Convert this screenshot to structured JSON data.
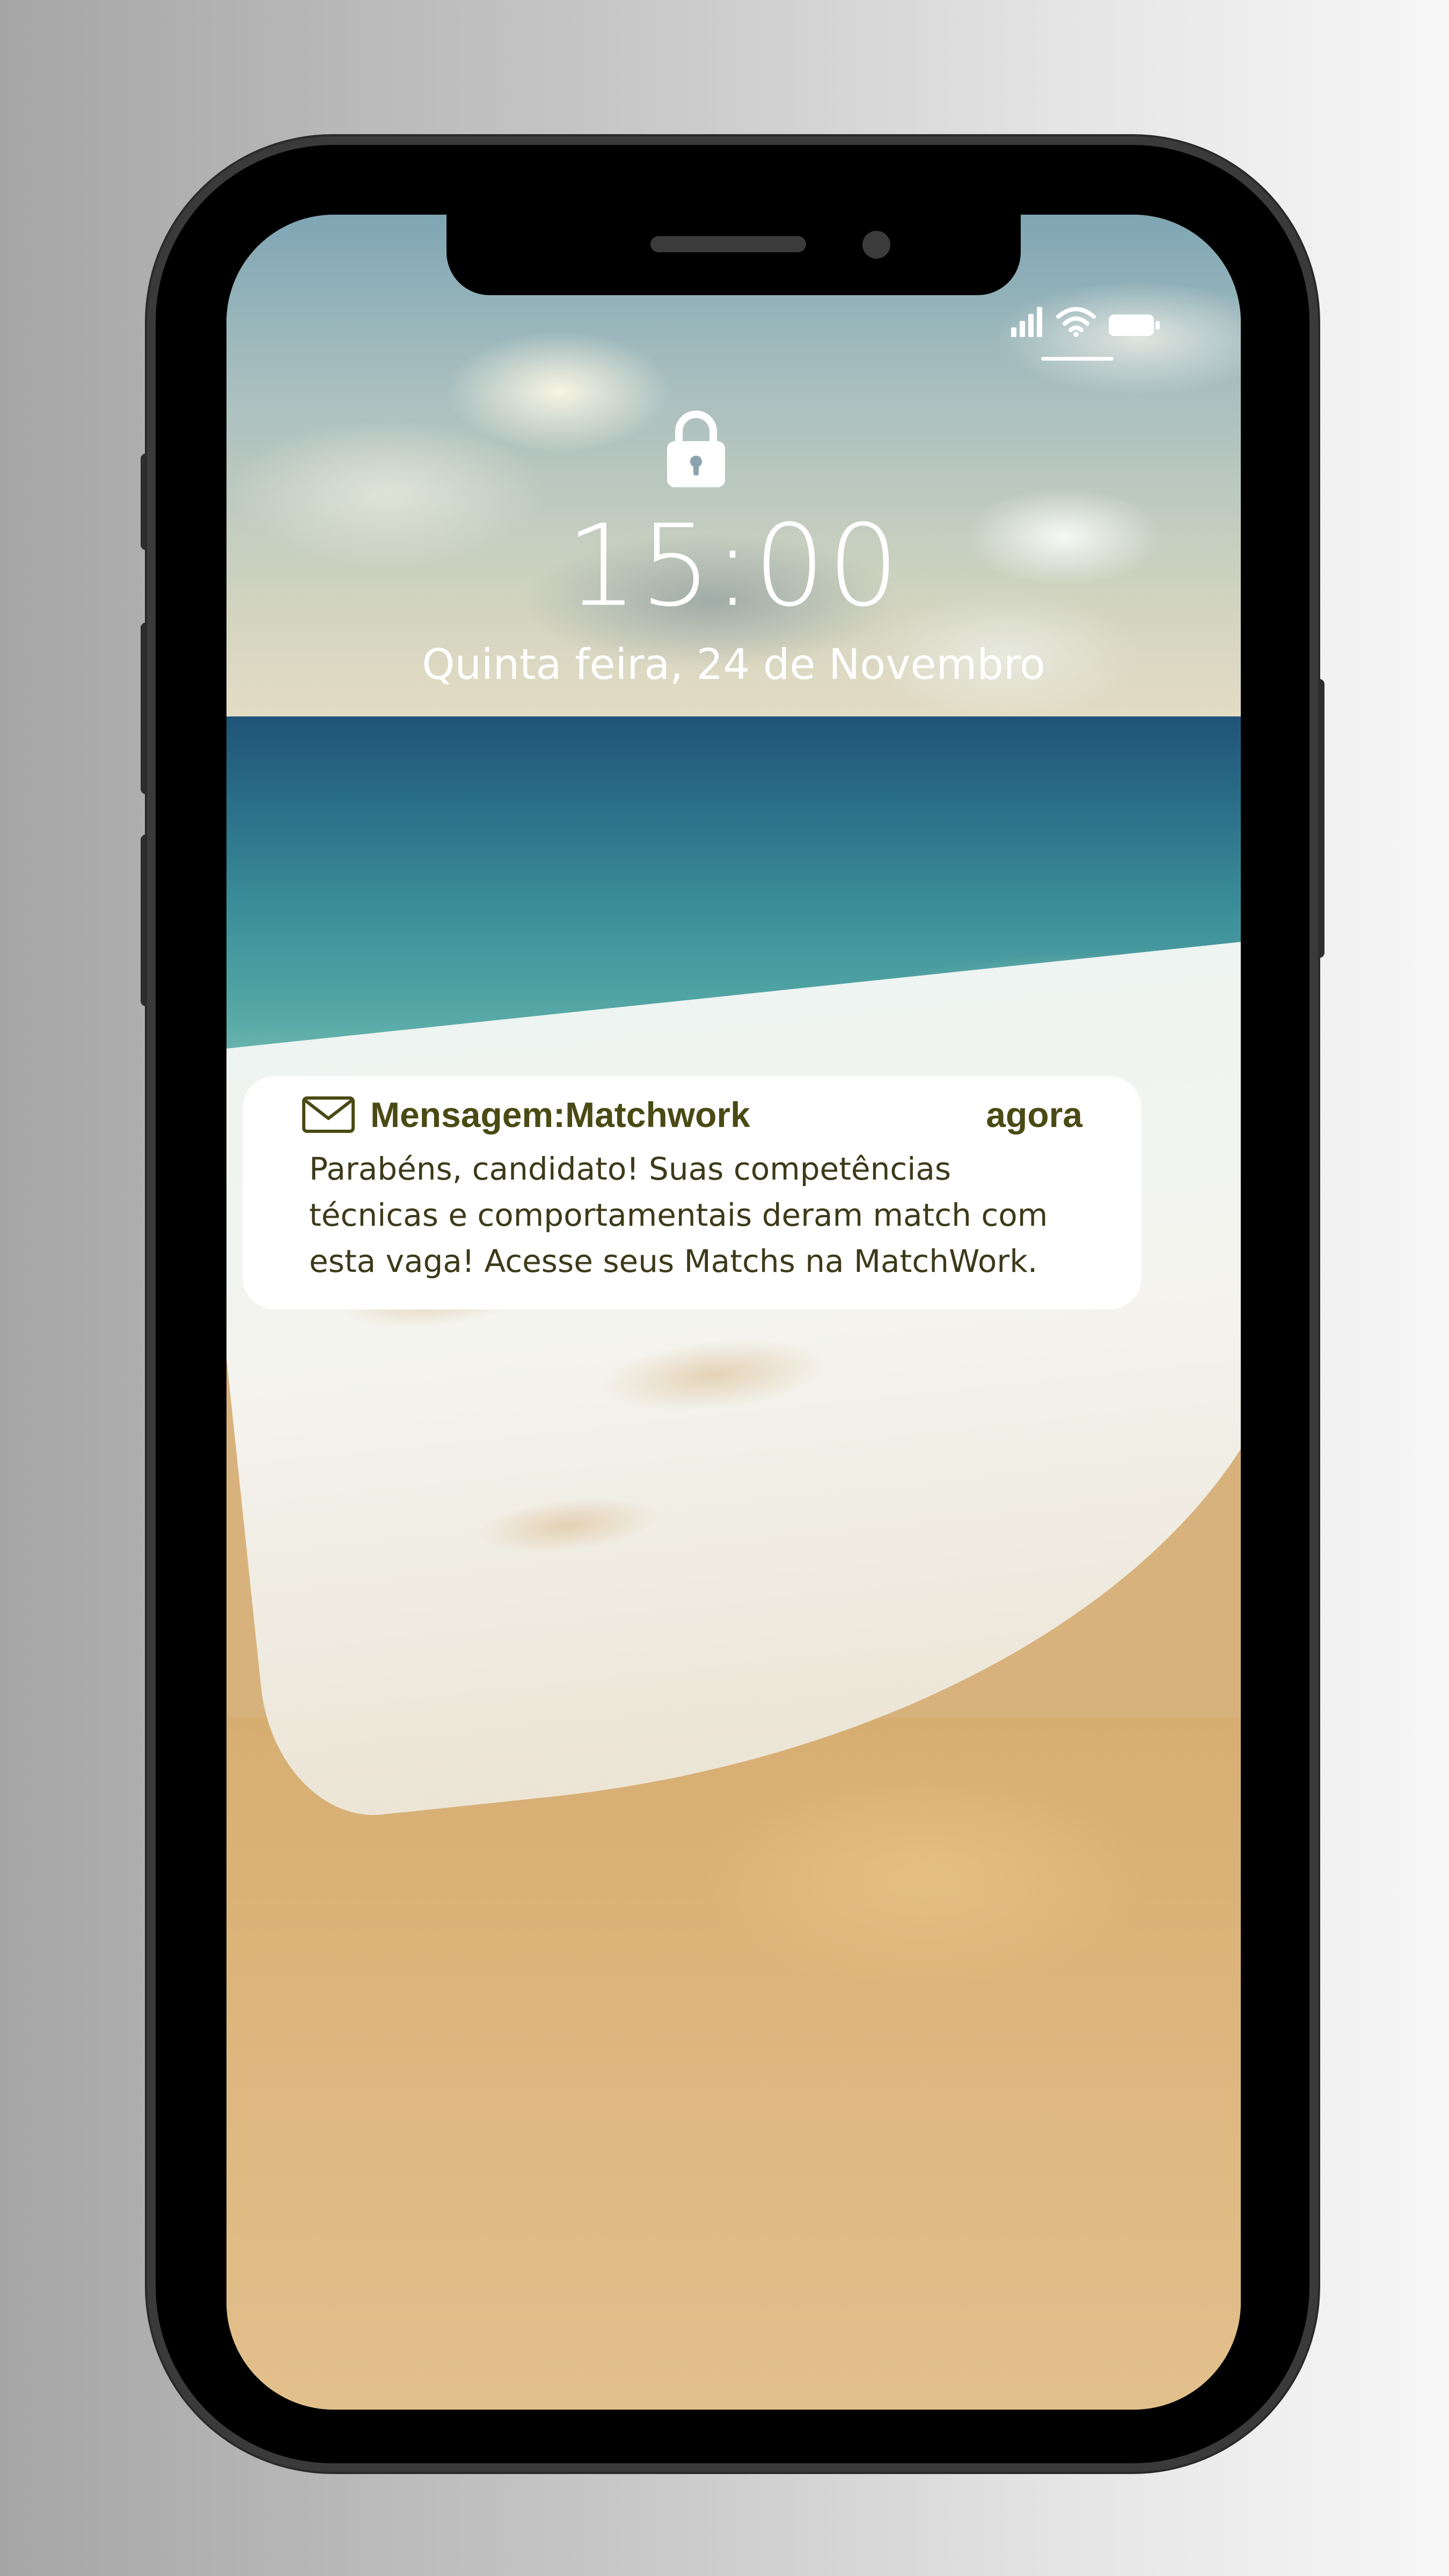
{
  "lockscreen": {
    "time": "15:00",
    "date": "Quinta feira, 24 de Novembro",
    "lock_icon": "lock-icon"
  },
  "status_bar": {
    "icons": [
      "cellular-signal-icon",
      "wifi-icon",
      "battery-icon"
    ]
  },
  "notification": {
    "app_icon": "mail-icon",
    "title": "Mensagem:Matchwork",
    "time": "agora",
    "body": "Parabéns, candidato! Suas competências técnicas e comportamentais deram match com esta vaga! Acesse seus Matchs na MatchWork."
  },
  "colors": {
    "notification_text": "#4a4a14",
    "notification_background": "#ffffff",
    "clock_text": "#ffffff"
  }
}
